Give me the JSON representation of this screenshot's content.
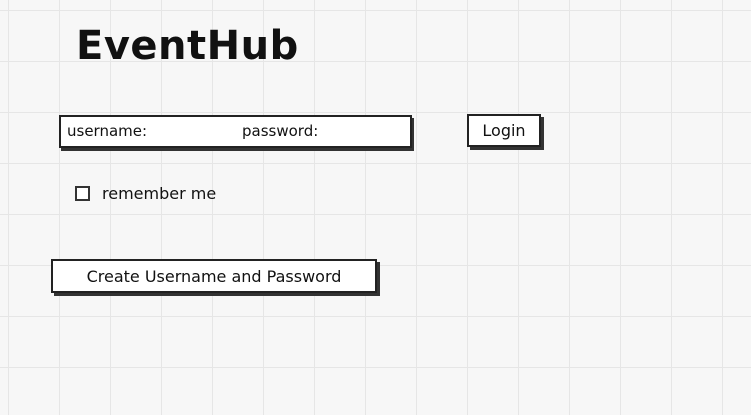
{
  "app": {
    "title": "EventHub"
  },
  "login_form": {
    "username_label": "username:",
    "password_label": "password:",
    "login_button": "Login",
    "remember_label": "remember me",
    "remember_checked": false
  },
  "signup": {
    "create_button": "Create Username and Password"
  },
  "colors": {
    "background": "#f7f7f7",
    "grid": "#e6e6e6",
    "ink": "#222222"
  }
}
